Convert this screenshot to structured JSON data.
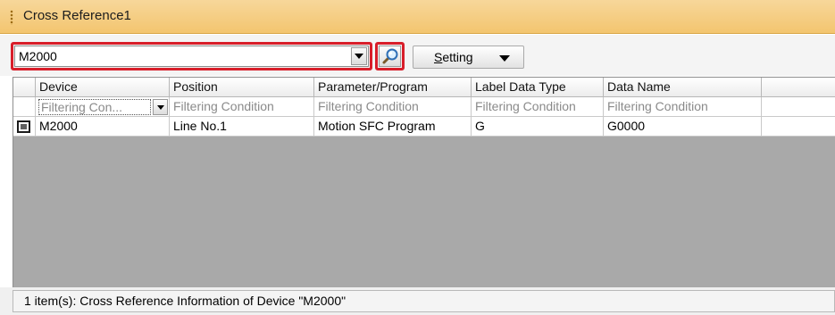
{
  "window": {
    "title": "Cross Reference1"
  },
  "toolbar": {
    "device_combo_value": "M2000",
    "search_button_icon": "magnifier-icon",
    "setting_label": "Setting"
  },
  "grid": {
    "columns": [
      "Device",
      "Position",
      "Parameter/Program",
      "Label Data Type",
      "Data Name",
      ""
    ],
    "filters": [
      "Filtering Con...",
      "Filtering Condition",
      "Filtering Condition",
      "Filtering Condition",
      "Filtering Condition"
    ],
    "rows": [
      {
        "device": "M2000",
        "position": "Line No.1",
        "program": "Motion SFC Program",
        "label_type": "G",
        "data_name": "G0000"
      }
    ]
  },
  "status": {
    "text": "1 item(s): Cross Reference Information of Device \"M2000\""
  },
  "colors": {
    "title_bar": "#f3c56f",
    "highlight": "#d81e2a",
    "grid_empty": "#a9a9a9"
  }
}
